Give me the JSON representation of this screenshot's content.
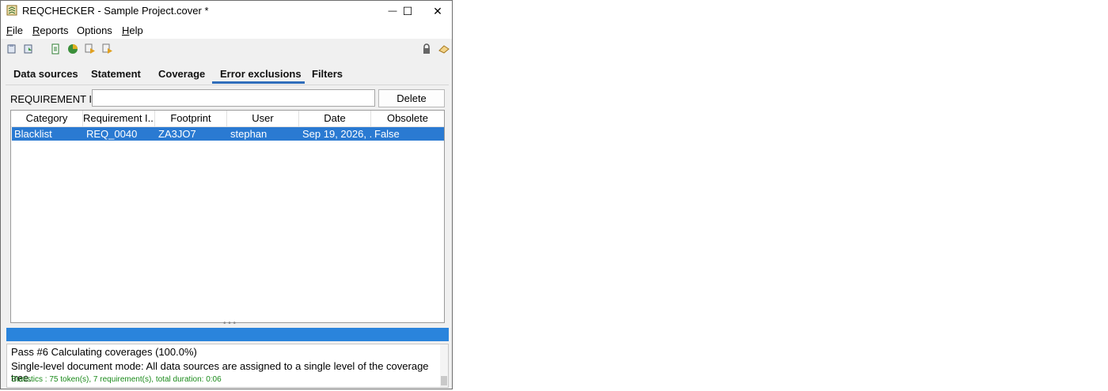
{
  "window": {
    "title": "REQCHECKER - Sample Project.cover *",
    "minimize_glyph": "—",
    "maximize_glyph": "☐",
    "close_glyph": "✕"
  },
  "menu": {
    "items": [
      "File",
      "Reports",
      "Options",
      "Help"
    ],
    "mnemonics": [
      0,
      0,
      -1,
      0
    ]
  },
  "toolbar": {
    "left_icons": [
      "open-icon",
      "save-icon",
      "report-icon",
      "coverage-pie-icon",
      "run-icon",
      "run-all-icon"
    ],
    "right_icons": [
      "lock-icon",
      "eraser-icon"
    ]
  },
  "tabs": {
    "items": [
      "Data sources",
      "Statement",
      "Coverage",
      "Error exclusions",
      "Filters"
    ],
    "active_index": 3
  },
  "filter": {
    "label": "REQUIREMENT ID",
    "value": "",
    "delete_label": "Delete"
  },
  "table": {
    "columns": [
      "Category",
      "Requirement I...",
      "Footprint",
      "User",
      "Date",
      "Obsolete"
    ],
    "rows": [
      {
        "category": "Blacklist",
        "requirement": "REQ_0040",
        "footprint": "ZA3JO7",
        "user": "stephan",
        "date": "Sep 19, 2026, ...",
        "obsolete": "False"
      }
    ],
    "selected_row": 0
  },
  "progress": {
    "fraction": 1.0
  },
  "status": {
    "line1": "Pass #6 Calculating coverages (100.0%)",
    "line2": "Single-level document mode: All data sources are assigned to a single level of the coverage tree.",
    "line3": "Statistics : 75 token(s), 7 requirement(s), total duration: 0:06"
  },
  "colors": {
    "selection": "#2a7ad2",
    "progress": "#2a84dc",
    "tab_accent": "#2f6dba",
    "stats_text": "#1a8a1a"
  }
}
